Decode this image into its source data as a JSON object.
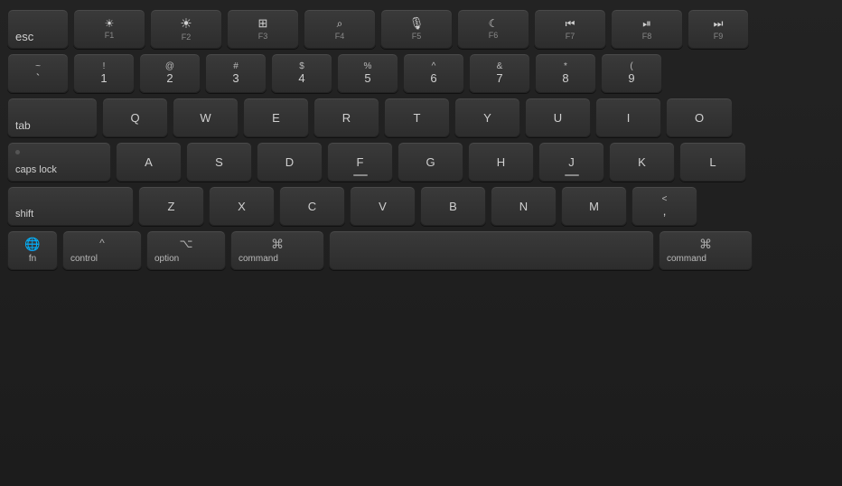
{
  "keyboard": {
    "rows": {
      "row1": {
        "keys": [
          {
            "id": "esc",
            "label": "esc",
            "type": "modifier"
          },
          {
            "id": "f1",
            "fn_icon": "☀",
            "fn_label": "F1",
            "type": "function"
          },
          {
            "id": "f2",
            "fn_icon": "☀",
            "fn_label": "F2",
            "type": "function"
          },
          {
            "id": "f3",
            "fn_icon": "⊞",
            "fn_label": "F3",
            "type": "function"
          },
          {
            "id": "f4",
            "fn_icon": "⌕",
            "fn_label": "F4",
            "type": "function"
          },
          {
            "id": "f5",
            "fn_icon": "🎙",
            "fn_label": "F5",
            "type": "function"
          },
          {
            "id": "f6",
            "fn_icon": "☾",
            "fn_label": "F6",
            "type": "function"
          },
          {
            "id": "f7",
            "fn_icon": "⏮",
            "fn_label": "F7",
            "type": "function"
          },
          {
            "id": "f8",
            "fn_icon": "⏯",
            "fn_label": "F8",
            "type": "function"
          },
          {
            "id": "f9",
            "fn_icon": "⏭",
            "fn_label": "F9",
            "type": "function"
          }
        ]
      },
      "row2": {
        "keys": [
          {
            "id": "backtick",
            "top": "~",
            "base": "`",
            "type": "dual"
          },
          {
            "id": "1",
            "top": "!",
            "base": "1",
            "type": "dual"
          },
          {
            "id": "2",
            "top": "@",
            "base": "2",
            "type": "dual"
          },
          {
            "id": "3",
            "top": "#",
            "base": "3",
            "type": "dual"
          },
          {
            "id": "4",
            "top": "$",
            "base": "4",
            "type": "dual"
          },
          {
            "id": "5",
            "top": "%",
            "base": "5",
            "type": "dual"
          },
          {
            "id": "6",
            "top": "^",
            "base": "6",
            "type": "dual"
          },
          {
            "id": "7",
            "top": "&",
            "base": "7",
            "type": "dual"
          },
          {
            "id": "8",
            "top": "*",
            "base": "8",
            "type": "dual"
          },
          {
            "id": "9",
            "top": "(",
            "base": "9",
            "type": "dual"
          }
        ]
      },
      "row3": {
        "keys": [
          {
            "id": "tab",
            "label": "tab",
            "type": "modifier"
          },
          {
            "id": "q",
            "label": "Q",
            "type": "letter"
          },
          {
            "id": "w",
            "label": "W",
            "type": "letter"
          },
          {
            "id": "e",
            "label": "E",
            "type": "letter"
          },
          {
            "id": "r",
            "label": "R",
            "type": "letter"
          },
          {
            "id": "t",
            "label": "T",
            "type": "letter"
          },
          {
            "id": "y",
            "label": "Y",
            "type": "letter"
          },
          {
            "id": "u",
            "label": "U",
            "type": "letter"
          },
          {
            "id": "i",
            "label": "I",
            "type": "letter"
          },
          {
            "id": "o",
            "label": "O",
            "type": "letter"
          }
        ]
      },
      "row4": {
        "keys": [
          {
            "id": "caps",
            "label": "caps lock",
            "type": "modifier"
          },
          {
            "id": "a",
            "label": "A",
            "type": "letter"
          },
          {
            "id": "s",
            "label": "S",
            "type": "letter"
          },
          {
            "id": "d",
            "label": "D",
            "type": "letter"
          },
          {
            "id": "f",
            "label": "F",
            "type": "letter"
          },
          {
            "id": "g",
            "label": "G",
            "type": "letter"
          },
          {
            "id": "h",
            "label": "H",
            "type": "letter"
          },
          {
            "id": "j",
            "label": "J",
            "type": "letter"
          },
          {
            "id": "k",
            "label": "K",
            "type": "letter"
          },
          {
            "id": "l",
            "label": "L",
            "type": "letter"
          }
        ]
      },
      "row5": {
        "keys": [
          {
            "id": "shift",
            "label": "shift",
            "type": "modifier"
          },
          {
            "id": "z",
            "label": "Z",
            "type": "letter"
          },
          {
            "id": "x",
            "label": "X",
            "type": "letter"
          },
          {
            "id": "c",
            "label": "C",
            "type": "letter"
          },
          {
            "id": "v",
            "label": "V",
            "type": "letter"
          },
          {
            "id": "b",
            "label": "B",
            "type": "letter"
          },
          {
            "id": "n",
            "label": "N",
            "type": "letter"
          },
          {
            "id": "m",
            "label": "M",
            "type": "letter"
          },
          {
            "id": "comma",
            "top": "<",
            "base": ",",
            "type": "dual"
          }
        ]
      },
      "row6": {
        "fn_label": "fn",
        "globe_icon": "🌐",
        "control_top": "^",
        "control_label": "control",
        "option_top": "⌥",
        "option_label": "option",
        "command_top": "⌘",
        "command_label": "command",
        "space_label": ""
      }
    }
  }
}
